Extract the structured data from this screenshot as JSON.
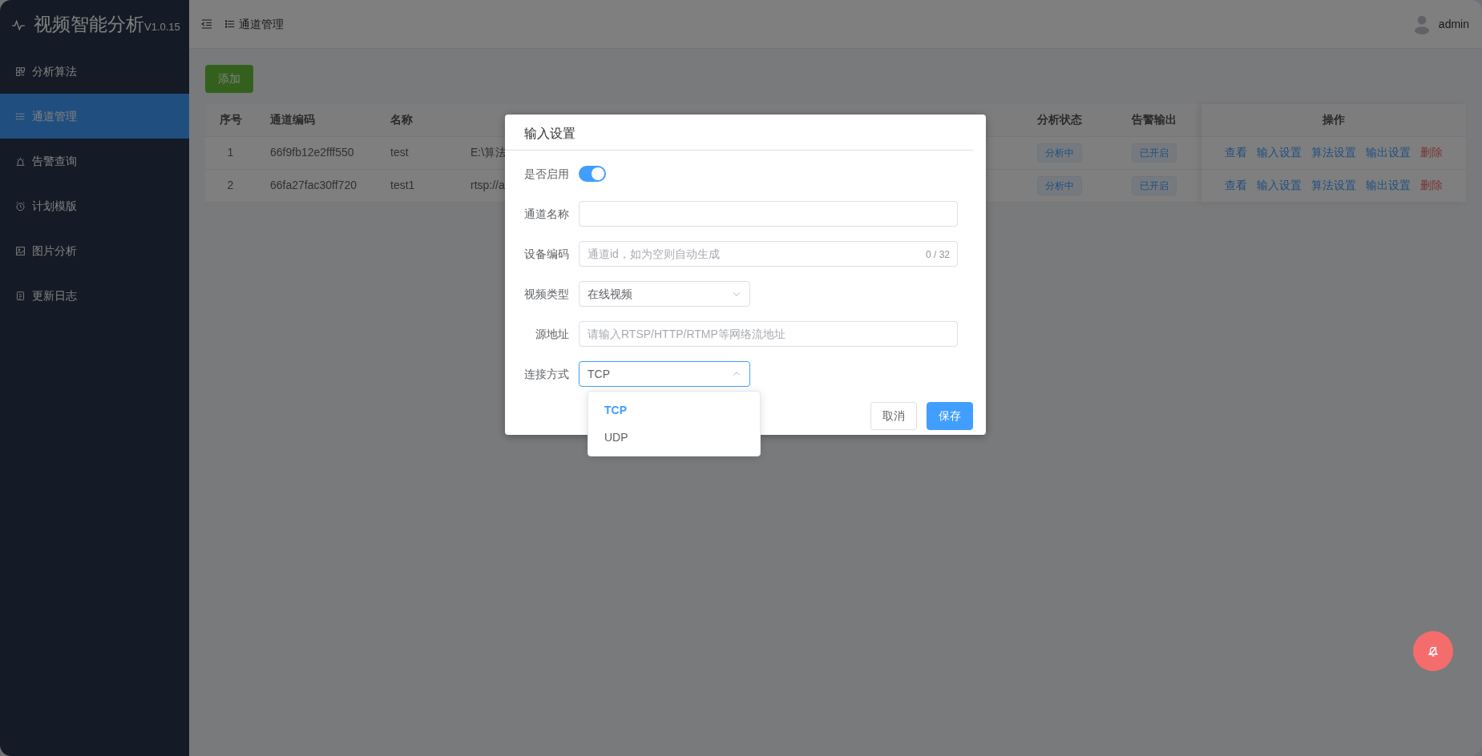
{
  "app": {
    "title": "视频智能分析",
    "version": "V1.0.15"
  },
  "sidebar": {
    "items": [
      {
        "label": "分析算法",
        "selected": false
      },
      {
        "label": "通道管理",
        "selected": true
      },
      {
        "label": "告警查询",
        "selected": false
      },
      {
        "label": "计划模版",
        "selected": false
      },
      {
        "label": "图片分析",
        "selected": false
      },
      {
        "label": "更新日志",
        "selected": false
      }
    ]
  },
  "header": {
    "breadcrumb": "通道管理",
    "user": "admin"
  },
  "toolbar": {
    "add_button": "添加"
  },
  "table": {
    "columns": {
      "index": "序号",
      "code": "通道编码",
      "name": "名称",
      "analysis_status": "分析状态",
      "alarm_output": "告警输出",
      "actions": "操作"
    },
    "rows": [
      {
        "index": "1",
        "code": "66f9fb12e2fff550",
        "name": "test",
        "column_4": "E:\\算法",
        "analysis_status": "分析中",
        "alarm_output": "已开启",
        "actions": [
          {
            "label": "查看",
            "kind": "link"
          },
          {
            "label": "输入设置",
            "kind": "link"
          },
          {
            "label": "算法设置",
            "kind": "link"
          },
          {
            "label": "输出设置",
            "kind": "link"
          },
          {
            "label": "删除",
            "kind": "danger"
          }
        ]
      },
      {
        "index": "2",
        "code": "66fa27fac30ff720",
        "name": "test1",
        "column_4": "rtsp://a",
        "analysis_status": "分析中",
        "alarm_output": "已开启",
        "actions": [
          {
            "label": "查看",
            "kind": "link"
          },
          {
            "label": "输入设置",
            "kind": "link"
          },
          {
            "label": "算法设置",
            "kind": "link"
          },
          {
            "label": "输出设置",
            "kind": "link"
          },
          {
            "label": "删除",
            "kind": "danger"
          }
        ]
      }
    ]
  },
  "dialog": {
    "title": "输入设置",
    "fields": [
      {
        "kind": "switch",
        "label": "是否启用",
        "on": true
      },
      {
        "kind": "input",
        "label": "通道名称"
      },
      {
        "kind": "input",
        "label": "设备编码",
        "placeholder": "通道id，如为空则自动生成",
        "counter": "0 / 32"
      },
      {
        "kind": "select",
        "label": "视频类型",
        "value": "在线视频",
        "expanded": false
      },
      {
        "kind": "input",
        "label": "源地址",
        "placeholder": "请输入RTSP/HTTP/RTMP等网络流地址"
      },
      {
        "kind": "select",
        "label": "连接方式",
        "value": "TCP",
        "expanded": true,
        "options": [
          {
            "label": "TCP",
            "selected": true
          },
          {
            "label": "UDP",
            "selected": false
          }
        ]
      }
    ],
    "buttons": [
      {
        "label": "取消",
        "kind": "default"
      },
      {
        "label": "保存",
        "kind": "primary"
      }
    ]
  }
}
